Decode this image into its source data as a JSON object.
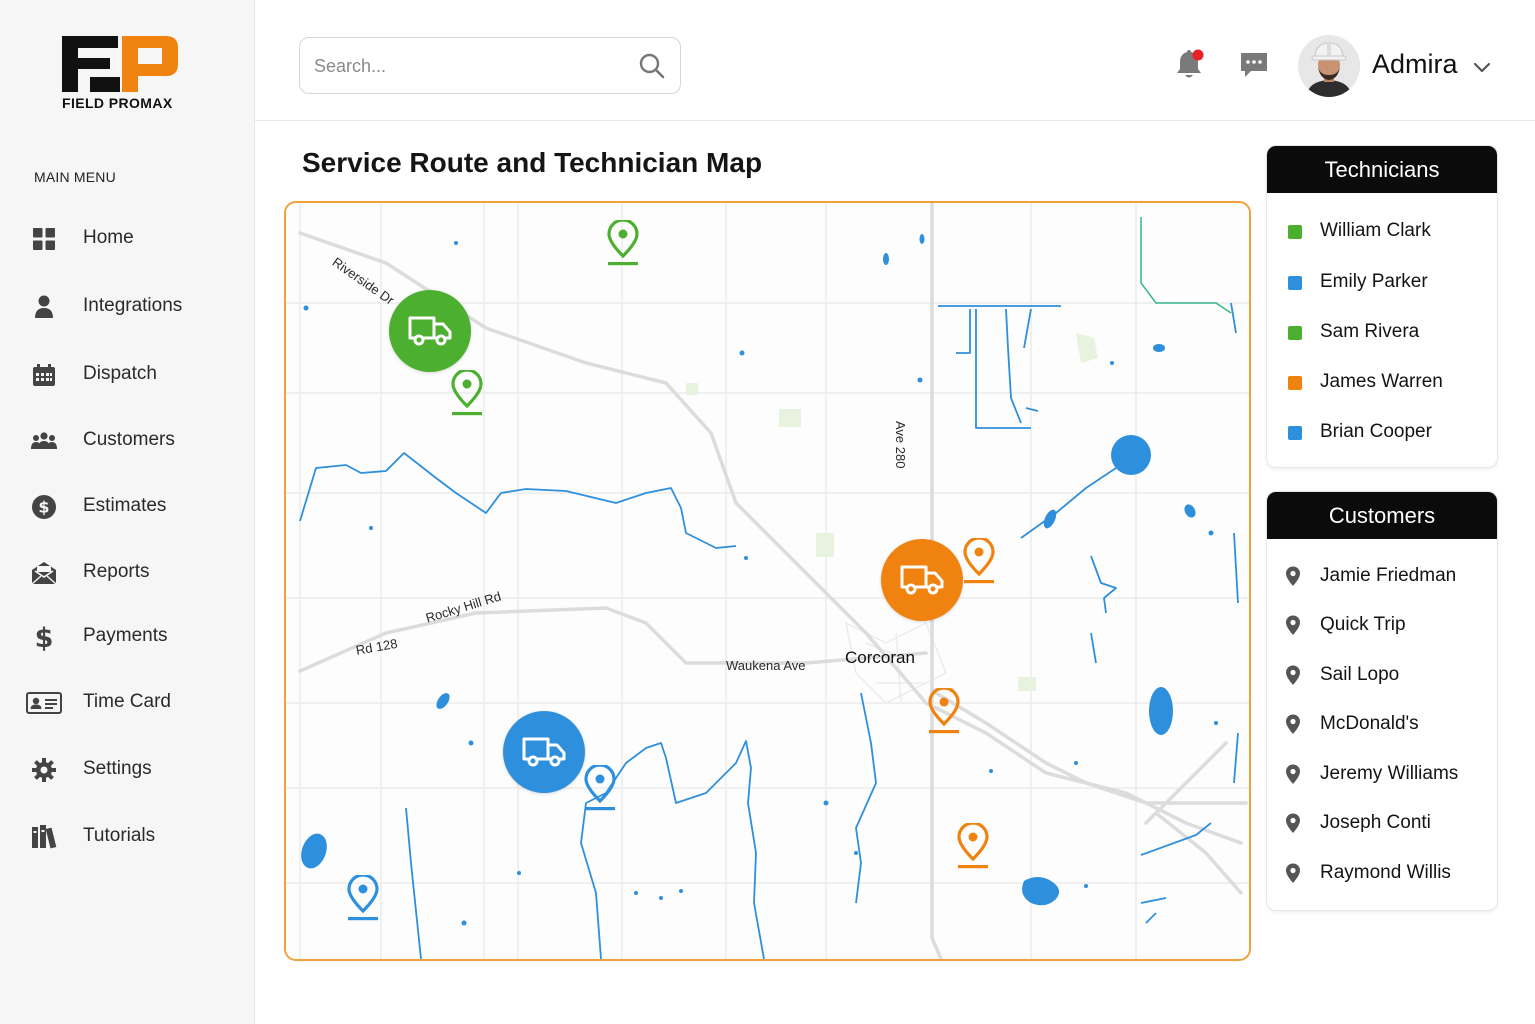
{
  "brand": {
    "name": "FIELD PROMAX",
    "colors": {
      "orange": "#f0820f",
      "black": "#111111"
    }
  },
  "sidebar": {
    "menu_title": "MAIN MENU",
    "items": [
      {
        "label": "Home",
        "icon": "grid-icon"
      },
      {
        "label": "Integrations",
        "icon": "person-icon"
      },
      {
        "label": "Dispatch",
        "icon": "calendar-icon"
      },
      {
        "label": "Customers",
        "icon": "group-icon"
      },
      {
        "label": "Estimates",
        "icon": "dollar-circle-icon"
      },
      {
        "label": "Reports",
        "icon": "envelope-icon"
      },
      {
        "label": "Payments",
        "icon": "dollar-icon"
      },
      {
        "label": "Time Card",
        "icon": "id-card-icon"
      },
      {
        "label": "Settings",
        "icon": "gear-icon"
      },
      {
        "label": "Tutorials",
        "icon": "books-icon"
      }
    ]
  },
  "header": {
    "search_placeholder": "Search...",
    "user_name": "Admira",
    "notification_dot_color": "#e8202a"
  },
  "page": {
    "title": "Service Route and Technician Map"
  },
  "map": {
    "road_labels": {
      "riverside": "Riverside Dr",
      "rocky_hill": "Rocky Hill Rd",
      "rd128": "Rd 128",
      "waukena": "Waukena Ave",
      "ave280": "Ave 280"
    },
    "town": "Corcoran",
    "colors": {
      "green": "#4caf2f",
      "orange": "#f0820f",
      "blue": "#2e8fdc",
      "water": "#2e8fdc",
      "road": "#dcdcdc"
    }
  },
  "technicians": {
    "title": "Technicians",
    "items": [
      {
        "name": "William Clark",
        "color": "#4caf2f"
      },
      {
        "name": "Emily Parker",
        "color": "#2e8fdc"
      },
      {
        "name": "Sam Rivera",
        "color": "#4caf2f"
      },
      {
        "name": "James Warren",
        "color": "#f0820f"
      },
      {
        "name": "Brian Cooper",
        "color": "#2e8fdc"
      }
    ]
  },
  "customers": {
    "title": "Customers",
    "items": [
      {
        "name": "Jamie Friedman"
      },
      {
        "name": "Quick Trip"
      },
      {
        "name": "Sail Lopo"
      },
      {
        "name": "McDonald's"
      },
      {
        "name": "Jeremy Williams"
      },
      {
        "name": "Joseph Conti"
      },
      {
        "name": "Raymond Willis"
      }
    ]
  }
}
